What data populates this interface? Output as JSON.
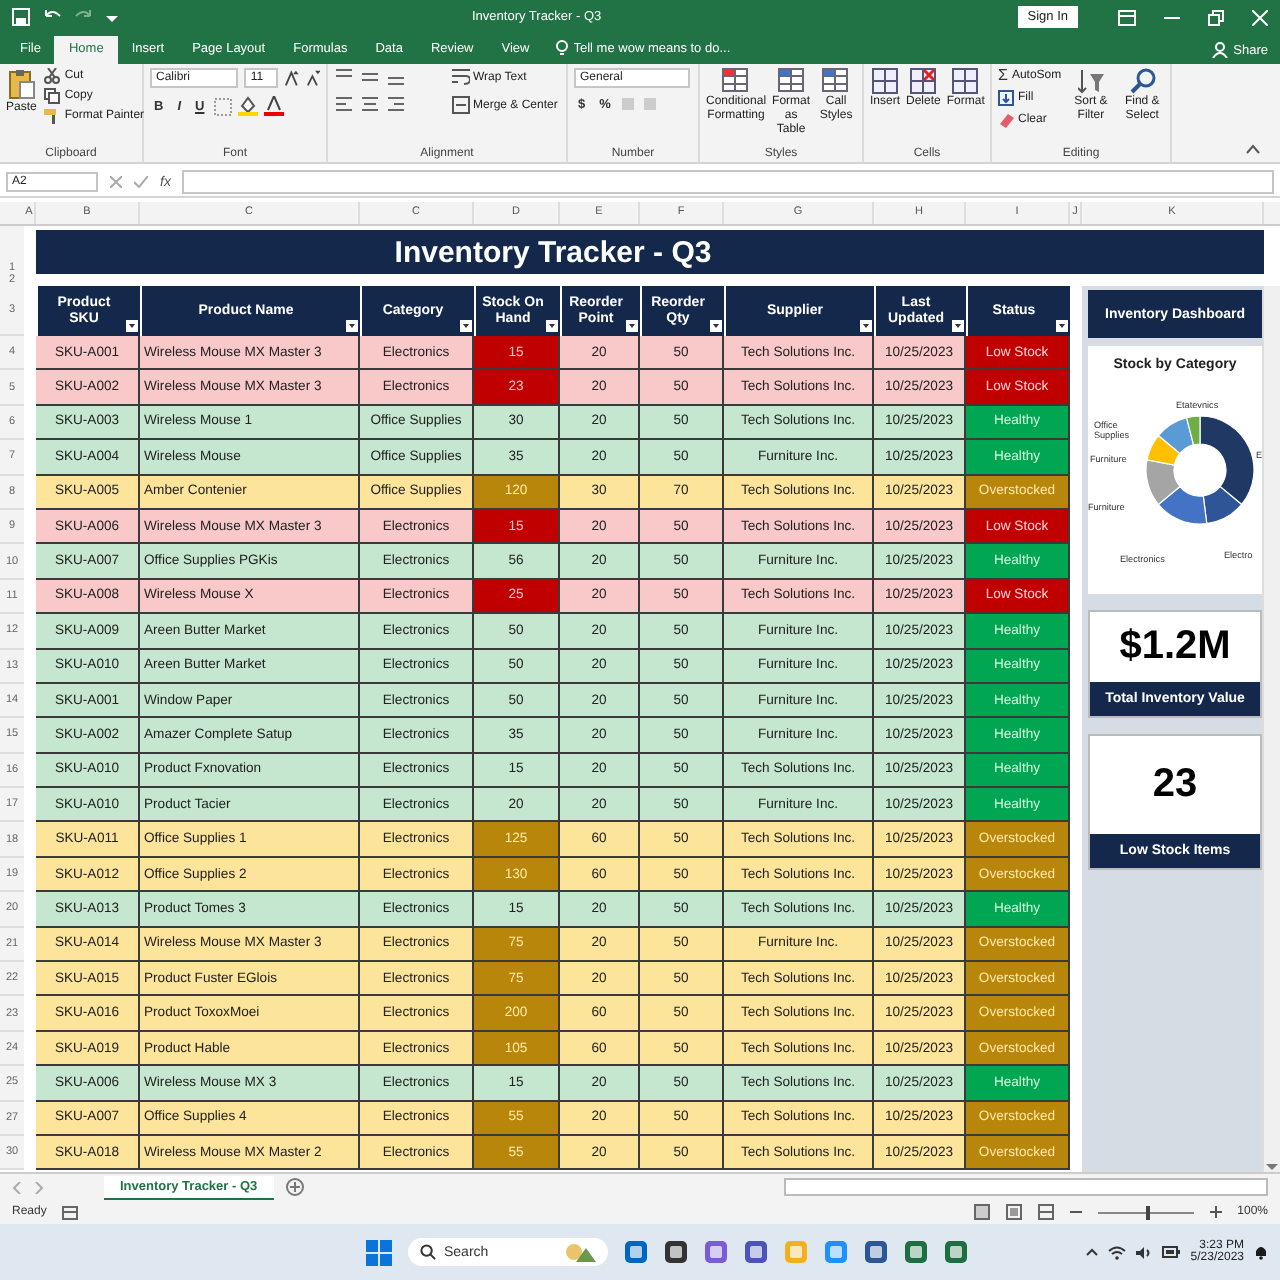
{
  "window": {
    "title": "Inventory Tracker - Q3",
    "sign_in": "Sign In"
  },
  "tabs": [
    {
      "label": "File",
      "selected": false
    },
    {
      "label": "Home",
      "selected": true
    },
    {
      "label": "Insert",
      "selected": false
    },
    {
      "label": "Page Layout",
      "selected": false
    },
    {
      "label": "Formulas",
      "selected": false
    },
    {
      "label": "Data",
      "selected": false
    },
    {
      "label": "Review",
      "selected": false
    },
    {
      "label": "View",
      "selected": false
    }
  ],
  "tell_me": {
    "placeholder": "Tell me wow means to do..."
  },
  "share": "Share",
  "ribbon": {
    "clipboard": {
      "paste": "Paste",
      "cut": "Cut",
      "copy": "Copy",
      "format_painter": "Format Painter",
      "label": "Clipboard"
    },
    "font": {
      "name": "Calibri",
      "size": "11",
      "styles": [
        "B",
        "I",
        "U"
      ],
      "label": "Font"
    },
    "alignment": {
      "wrap": "Wrap Text",
      "merge": "Merge & Center",
      "label": "Alignment"
    },
    "number": {
      "format": "General",
      "symbols": [
        "$",
        "%"
      ],
      "label": "Number"
    },
    "styles": {
      "buttons": [
        "Conditional Formatting",
        "Format as Table",
        "Call Styles"
      ],
      "label": "Styles"
    },
    "cells": {
      "buttons": [
        "Insert",
        "Delete",
        "Format"
      ],
      "label": "Cells"
    },
    "editing": {
      "autosum_icon": "Σ",
      "autosum": "AutoSom",
      "fill": "Fill",
      "clear": "Clear",
      "sort": "Sort & Filter",
      "find": "Find & Select",
      "label": "Editing"
    }
  },
  "formula_bar": {
    "name_box": "A2",
    "fx": "fx"
  },
  "sheet": {
    "column_headers": [
      "A",
      "B",
      "C",
      "C",
      "D",
      "E",
      "F",
      "G",
      "H",
      "I",
      "J",
      "K"
    ],
    "title_rows": [
      "1",
      "2"
    ],
    "title": "Inventory Tracker - Q3",
    "header_row": "3",
    "columns": [
      "Product SKU",
      "Product Name",
      "Category",
      "Stock On Hand",
      "Reorder Point",
      "Reorder Qty",
      "Supplier",
      "Last Updated",
      "Status"
    ],
    "rows": [
      {
        "num": "4",
        "kind": "low",
        "cells": [
          "SKU-A001",
          "Wireless Mouse MX Master 3",
          "Electronics",
          "15",
          "20",
          "50",
          "Tech Solutions Inc.",
          "10/25/2023",
          "Low Stock"
        ]
      },
      {
        "num": "5",
        "kind": "low",
        "cells": [
          "SKU-A002",
          "Wireless Mouse MX Master 3",
          "Electronics",
          "23",
          "20",
          "50",
          "Tech Solutions Inc.",
          "10/25/2023",
          "Low Stock"
        ]
      },
      {
        "num": "6",
        "kind": "healthy",
        "cells": [
          "SKU-A003",
          "Wireless Mouse 1",
          "Office Supplies",
          "30",
          "20",
          "50",
          "Tech Solutions Inc.",
          "10/25/2023",
          "Healthy"
        ]
      },
      {
        "num": "7",
        "kind": "healthy",
        "cells": [
          "SKU-A004",
          "Wireless Mouse",
          "Office Supplies",
          "35",
          "20",
          "50",
          "Furniture Inc.",
          "10/25/2023",
          "Healthy"
        ]
      },
      {
        "num": "8",
        "kind": "over",
        "cells": [
          "SKU-A005",
          "Amber Contenier",
          "Office Supplies",
          "120",
          "30",
          "70",
          "Tech Solutions Inc.",
          "10/25/2023",
          "Overstocked"
        ]
      },
      {
        "num": "9",
        "kind": "low",
        "cells": [
          "SKU-A006",
          "Wireless Mouse MX Master 3",
          "Electronics",
          "15",
          "20",
          "50",
          "Tech Solutions Inc.",
          "10/25/2023",
          "Low Stock"
        ]
      },
      {
        "num": "10",
        "kind": "healthy",
        "cells": [
          "SKU-A007",
          "Office Supplies PGKis",
          "Electronics",
          "56",
          "20",
          "50",
          "Furniture Inc.",
          "10/25/2023",
          "Healthy"
        ]
      },
      {
        "num": "11",
        "kind": "low",
        "cells": [
          "SKU-A008",
          "Wireless Mouse X",
          "Electronics",
          "25",
          "20",
          "50",
          "Tech Solutions Inc.",
          "10/25/2023",
          "Low Stock"
        ]
      },
      {
        "num": "12",
        "kind": "healthy",
        "cells": [
          "SKU-A009",
          "Areen Butter Market",
          "Electronics",
          "50",
          "20",
          "50",
          "Furniture Inc.",
          "10/25/2023",
          "Healthy"
        ]
      },
      {
        "num": "13",
        "kind": "healthy",
        "cells": [
          "SKU-A010",
          "Areen Butter Market",
          "Electronics",
          "50",
          "20",
          "50",
          "Furniture Inc.",
          "10/25/2023",
          "Healthy"
        ]
      },
      {
        "num": "14",
        "kind": "healthy",
        "cells": [
          "SKU-A001",
          "Window Paper",
          "Electronics",
          "50",
          "20",
          "50",
          "Furniture Inc.",
          "10/25/2023",
          "Healthy"
        ]
      },
      {
        "num": "15",
        "kind": "healthy",
        "cells": [
          "SKU-A002",
          "Amazer Complete Satup",
          "Electronics",
          "35",
          "20",
          "50",
          "Furniture Inc.",
          "10/25/2023",
          "Healthy"
        ]
      },
      {
        "num": "16",
        "kind": "healthy",
        "cells": [
          "SKU-A010",
          "Product Fxnovation",
          "Electronics",
          "15",
          "20",
          "50",
          "Tech Solutions Inc.",
          "10/25/2023",
          "Healthy"
        ]
      },
      {
        "num": "17",
        "kind": "healthy",
        "cells": [
          "SKU-A010",
          "Product Tacier",
          "Electronics",
          "20",
          "20",
          "50",
          "Furniture Inc.",
          "10/25/2023",
          "Healthy"
        ]
      },
      {
        "num": "18",
        "kind": "over",
        "cells": [
          "SKU-A011",
          "Office Supplies 1",
          "Electronics",
          "125",
          "60",
          "50",
          "Tech Solutions Inc.",
          "10/25/2023",
          "Overstocked"
        ]
      },
      {
        "num": "19",
        "kind": "over",
        "cells": [
          "SKU-A012",
          "Office Supplies 2",
          "Electronics",
          "130",
          "60",
          "50",
          "Tech Solutions Inc.",
          "10/25/2023",
          "Overstocked"
        ]
      },
      {
        "num": "20",
        "kind": "healthy",
        "cells": [
          "SKU-A013",
          "Product Tomes 3",
          "Electronics",
          "15",
          "20",
          "50",
          "Tech Solutions Inc.",
          "10/25/2023",
          "Healthy"
        ]
      },
      {
        "num": "21",
        "kind": "over",
        "cells": [
          "SKU-A014",
          "Wireless Mouse MX Master 3",
          "Electronics",
          "75",
          "20",
          "50",
          "Furniture Inc.",
          "10/25/2023",
          "Overstocked"
        ]
      },
      {
        "num": "22",
        "kind": "over",
        "cells": [
          "SKU-A015",
          "Product Fuster EGlois",
          "Electronics",
          "75",
          "20",
          "50",
          "Tech Solutions Inc.",
          "10/25/2023",
          "Overstocked"
        ]
      },
      {
        "num": "23",
        "kind": "over",
        "cells": [
          "SKU-A016",
          "Product ToxoxMoei",
          "Electronics",
          "200",
          "60",
          "50",
          "Tech Solutions Inc.",
          "10/25/2023",
          "Overstocked"
        ]
      },
      {
        "num": "24",
        "kind": "over",
        "cells": [
          "SKU-A019",
          "Product Hable",
          "Electronics",
          "105",
          "60",
          "50",
          "Tech Solutions Inc.",
          "10/25/2023",
          "Overstocked"
        ]
      },
      {
        "num": "25",
        "kind": "healthy",
        "cells": [
          "SKU-A006",
          "Wireless Mouse MX 3",
          "Electronics",
          "15",
          "20",
          "50",
          "Tech Solutions Inc.",
          "10/25/2023",
          "Healthy"
        ]
      },
      {
        "num": "27",
        "kind": "over",
        "cells": [
          "SKU-A007",
          "Office Supplies 4",
          "Electronics",
          "55",
          "20",
          "50",
          "Tech Solutions Inc.",
          "10/25/2023",
          "Overstocked"
        ]
      },
      {
        "num": "30",
        "kind": "over",
        "cells": [
          "SKU-A018",
          "Wireless Mouse MX Master 2",
          "Electronics",
          "55",
          "20",
          "50",
          "Tech Solutions Inc.",
          "10/25/2023",
          "Overstocked"
        ]
      }
    ]
  },
  "dashboard": {
    "title": "Inventory Dashboard",
    "chart_title": "Stock by Category",
    "chart_labels": [
      "Etatevnics",
      "Office Supplies",
      "Furniture",
      "Furniture",
      "Electronics",
      "Electro",
      "E"
    ],
    "kpis": [
      {
        "value": "$1.2M",
        "label": "Total Inventory Value"
      },
      {
        "value": "23",
        "label": "Low Stock Items"
      }
    ]
  },
  "sheet_tab": "Inventory Tracker - Q3",
  "status_bar": {
    "status": "Ready",
    "zoom_slider": {
      "level": 0.5
    },
    "zoom": "100%"
  },
  "taskbar": {
    "search": "Search",
    "time": "3:23 PM",
    "date": "5/23/2023"
  }
}
